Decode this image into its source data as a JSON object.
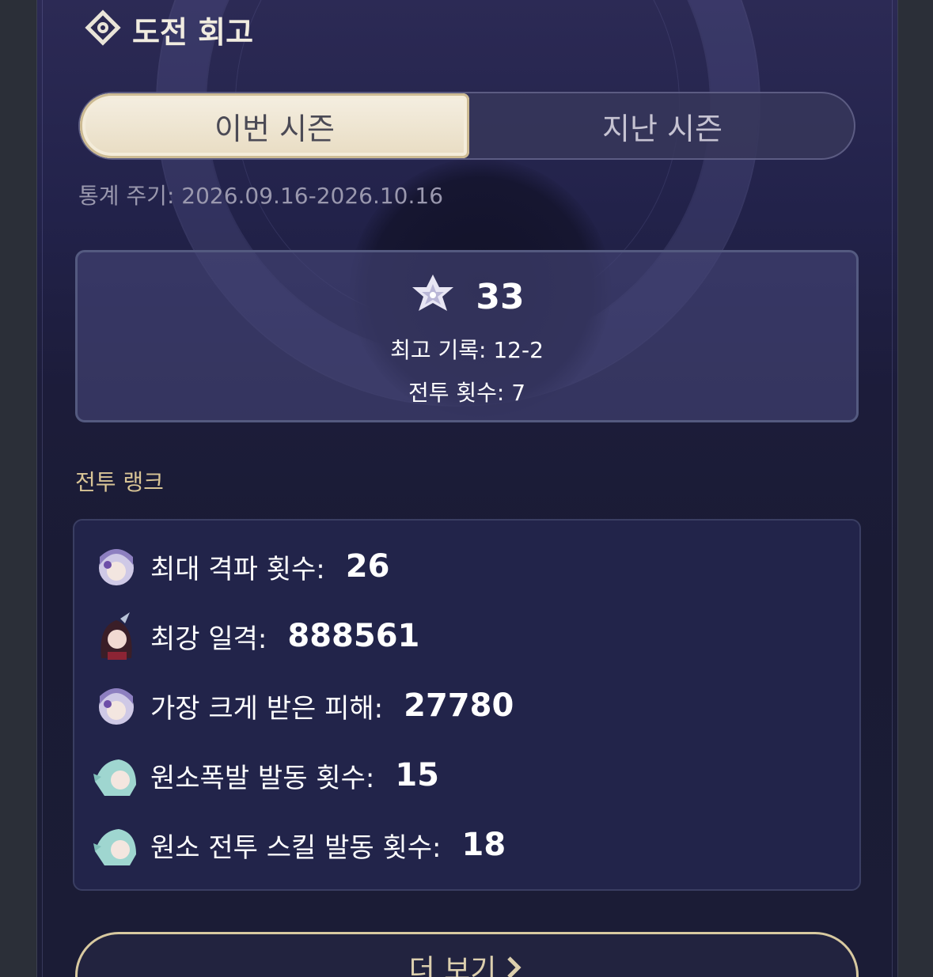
{
  "header": {
    "title": "도전 회고",
    "icon": "abyss-emblem-icon"
  },
  "tabs": [
    {
      "label": "이번 시즌",
      "active": true
    },
    {
      "label": "지난 시즌",
      "active": false
    }
  ],
  "period": "통계 주기: 2026.09.16-2026.10.16",
  "summary": {
    "icon": "star-emblem-icon",
    "stars": "33",
    "best_record": "최고 기록: 12-2",
    "battle_count": "전투 횟수: 7"
  },
  "section_label": "전투 랭크",
  "ranks": [
    {
      "label": "최대 격파 횟수:",
      "value": "26",
      "avatar": "maid-character-avatar"
    },
    {
      "label": "최강 일격:",
      "value": "888561",
      "avatar": "dark-hair-character-avatar"
    },
    {
      "label": "가장 크게 받은 피해:",
      "value": "27780",
      "avatar": "maid-character-avatar"
    },
    {
      "label": "원소폭발 발동 횟수:",
      "value": "15",
      "avatar": "mint-hair-character-avatar"
    },
    {
      "label": "원소 전투 스킬 발동 횟수:",
      "value": "18",
      "avatar": "mint-hair-character-avatar"
    }
  ],
  "more_button": {
    "label": "더 보기",
    "icon": "chevron-right-icon"
  },
  "colors": {
    "accent_gold": "#d9c596",
    "panel_bg": "#1c1c3a",
    "tab_active": "#f1e8d4"
  }
}
